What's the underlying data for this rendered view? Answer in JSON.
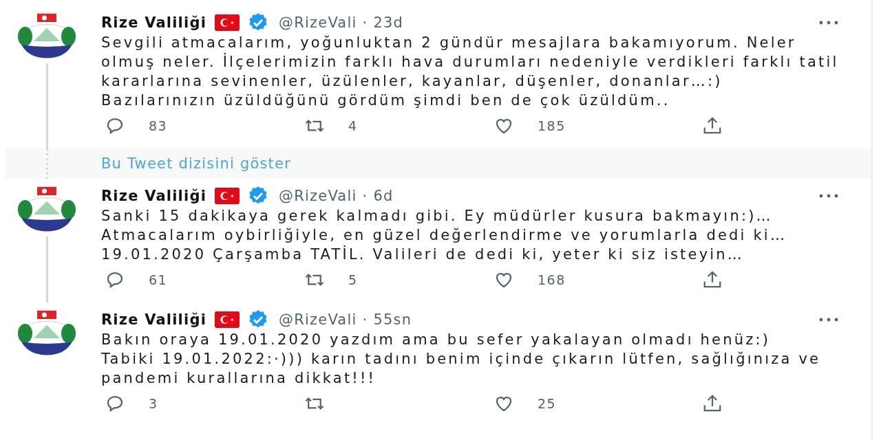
{
  "items": [
    {
      "kind": "tweet",
      "name": "Rize Valiliği",
      "verified": true,
      "handle": "@RizeVali",
      "separator": "·",
      "time": "23d",
      "thread_below": true,
      "text": "Sevgili atmacalarım, yoğunluktan 2 gündür mesajlara bakamıyorum. Neler\nolmuş neler. İlçelerimizin farklı hava durumları nedeniyle verdikleri farklı tatil\nkararlarına sevinenler, üzülenler, kayanlar, düşenler, donanlar…:)\nBazılarınızın üzüldüğünü gördüm şimdi ben de çok üzüldüm..",
      "replies": "83",
      "retweets": "4",
      "likes": "185"
    },
    {
      "kind": "show_thread",
      "label": "Bu Tweet dizisini göster"
    },
    {
      "kind": "tweet",
      "name": "Rize Valiliği",
      "verified": true,
      "handle": "@RizeVali",
      "separator": "·",
      "time": "6d",
      "thread_below": true,
      "text": "Sanki 15 dakikaya gerek kalmadı gibi. Ey müdürler kusura bakmayın:)…\nAtmacalarım oybirliğiyle, en güzel değerlendirme ve yorumlarla dedi ki…\n19.01.2020 Çarşamba TATİL. Valileri de dedi ki, yeter ki siz isteyin…",
      "replies": "61",
      "retweets": "5",
      "likes": "168"
    },
    {
      "kind": "tweet",
      "name": "Rize Valiliği",
      "verified": true,
      "handle": "@RizeVali",
      "separator": "·",
      "time": "55sn",
      "thread_below": false,
      "text": "Bakın oraya 19.01.2020 yazdım ama bu sefer yakalayan olmadı henüz:)\nTabiki 19.01.2022:·))) karın tadını benim içinde çıkarın lütfen, sağlığınıza ve\npandemi kurallarına dikkat!!!",
      "replies": "3",
      "likes": "25"
    }
  ]
}
